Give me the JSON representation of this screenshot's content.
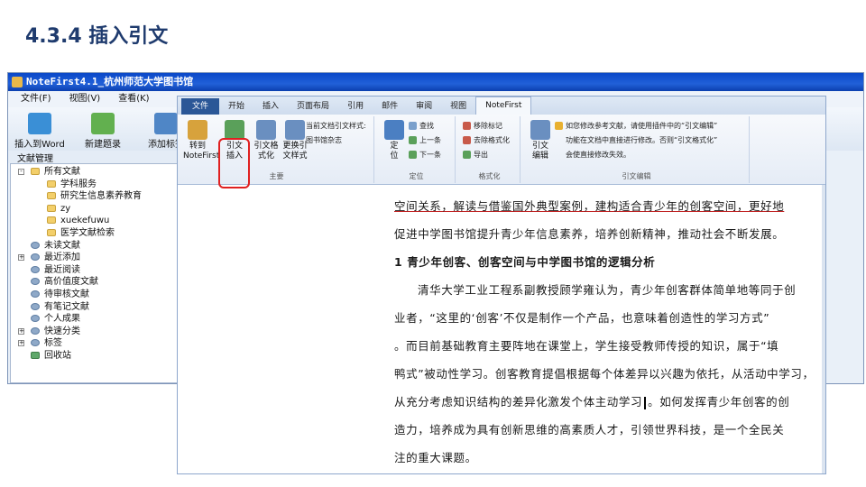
{
  "slide": {
    "title": "4.3.4 插入引文"
  },
  "notefirst": {
    "window_title": "NoteFirst4.1_杭州师范大学图书馆",
    "menu": [
      "文件(F)",
      "视图(V)",
      "查看(K)"
    ],
    "toolbar": [
      {
        "label": "插入到Word",
        "icon": "insert-word-icon",
        "color": "#3a8fd6"
      },
      {
        "label": "新建题录",
        "icon": "new-record-icon",
        "color": "#62b04f"
      },
      {
        "label": "添加标签",
        "icon": "add-tag-icon",
        "color": "#4f86c6"
      }
    ],
    "sidebar_title": "文献管理",
    "tree": [
      {
        "label": "所有文献",
        "level": 0,
        "icon": "folder",
        "expander": "-"
      },
      {
        "label": "学科服务",
        "level": 1,
        "icon": "folder"
      },
      {
        "label": "研究生信息素养教育",
        "level": 1,
        "icon": "folder"
      },
      {
        "label": "zy",
        "level": 1,
        "icon": "folder"
      },
      {
        "label": "xuekefuwu",
        "level": 1,
        "icon": "folder"
      },
      {
        "label": "医学文献检索",
        "level": 1,
        "icon": "folder"
      },
      {
        "label": "未读文献",
        "level": 0,
        "icon": "disc"
      },
      {
        "label": "最近添加",
        "level": 0,
        "icon": "disc",
        "expander": "+"
      },
      {
        "label": "最近阅读",
        "level": 0,
        "icon": "disc"
      },
      {
        "label": "高价值度文献",
        "level": 0,
        "icon": "disc"
      },
      {
        "label": "待审核文献",
        "level": 0,
        "icon": "disc"
      },
      {
        "label": "有笔记文献",
        "level": 0,
        "icon": "disc"
      },
      {
        "label": "个人成果",
        "level": 0,
        "icon": "disc"
      },
      {
        "label": "快速分类",
        "level": 0,
        "icon": "disc",
        "expander": "+"
      },
      {
        "label": "标签",
        "level": 0,
        "icon": "disc",
        "expander": "+"
      },
      {
        "label": "回收站",
        "level": 0,
        "icon": "recycle"
      }
    ]
  },
  "word": {
    "tabs": [
      "文件",
      "开始",
      "插入",
      "页面布局",
      "引用",
      "邮件",
      "审阅",
      "视图",
      "NoteFirst"
    ],
    "active_tab": "NoteFirst",
    "ribbon": {
      "main_group": {
        "label": "主要",
        "buttons": [
          {
            "label": "转到\nNoteFirst",
            "icon": "goto-notefirst-icon",
            "color": "#d7a23c"
          },
          {
            "label": "引文\n插入",
            "icon": "insert-citation-icon",
            "color": "#5aa05a",
            "highlighted": true
          },
          {
            "label": "引文格\n式化",
            "icon": "format-citation-icon",
            "color": "#6a8fc0"
          },
          {
            "label": "更换引\n文样式",
            "icon": "change-style-icon",
            "color": "#6a8fc0"
          }
        ],
        "small": [
          "当前文档引文样式:",
          "图书馆杂志"
        ]
      },
      "locate_group": {
        "label": "定位",
        "big": {
          "label": "定\n位",
          "icon": "locate-icon",
          "color": "#4b7fc2"
        },
        "small": [
          "查找",
          "上一条",
          "下一条"
        ]
      },
      "format_group": {
        "label": "格式化",
        "small": [
          "移除标记",
          "去除格式化",
          "导出"
        ]
      },
      "edit_group": {
        "label": "引文编辑",
        "big": {
          "label": "引文\n编辑",
          "icon": "citation-edit-icon",
          "color": "#6a8fc0"
        },
        "notes": [
          "如您修改参考文献，请使用插件中的“引文编辑”",
          "功能在文档中直接进行修改。否则“引文格式化”",
          "会使直接修改失效。"
        ]
      }
    },
    "document": [
      {
        "text": "空间关系，解读与借鉴国外典型案例，建构适合青少年的创客空间，更好地",
        "style": "normal"
      },
      {
        "text": "促进中学图书馆提升青少年信息素养，培养创新精神，推动社会不断发展。",
        "style": "normal"
      },
      {
        "text": "1 青少年创客、创客空间与中学图书馆的逻辑分析",
        "style": "heading"
      },
      {
        "text": "清华大学工业工程系副教授顾学雍认为，青少年创客群体简单地等同于创",
        "style": "normal"
      },
      {
        "text": "业者，“这里的‘创客’不仅是制作一个产品，也意味着创造性的学习方式”",
        "style": "normal"
      },
      {
        "text": "。而目前基础教育主要阵地在课堂上，学生接受教师传授的知识，属于“填",
        "style": "normal"
      },
      {
        "text": "鸭式”被动性学习。创客教育提倡根据每个体差异以兴趣为依托，从活动中学习，",
        "style": "normal"
      },
      {
        "text": "从充分考虑知识结构的差异化激发个体主动学习",
        "style": "normal",
        "cursor": true,
        "after": "。如何发挥青少年创客的创"
      },
      {
        "text": "造力，培养成为具有创新思维的高素质人才，引领世界科技，是一个全民关",
        "style": "normal"
      },
      {
        "text": "注的重大课题。",
        "style": "normal"
      }
    ]
  }
}
